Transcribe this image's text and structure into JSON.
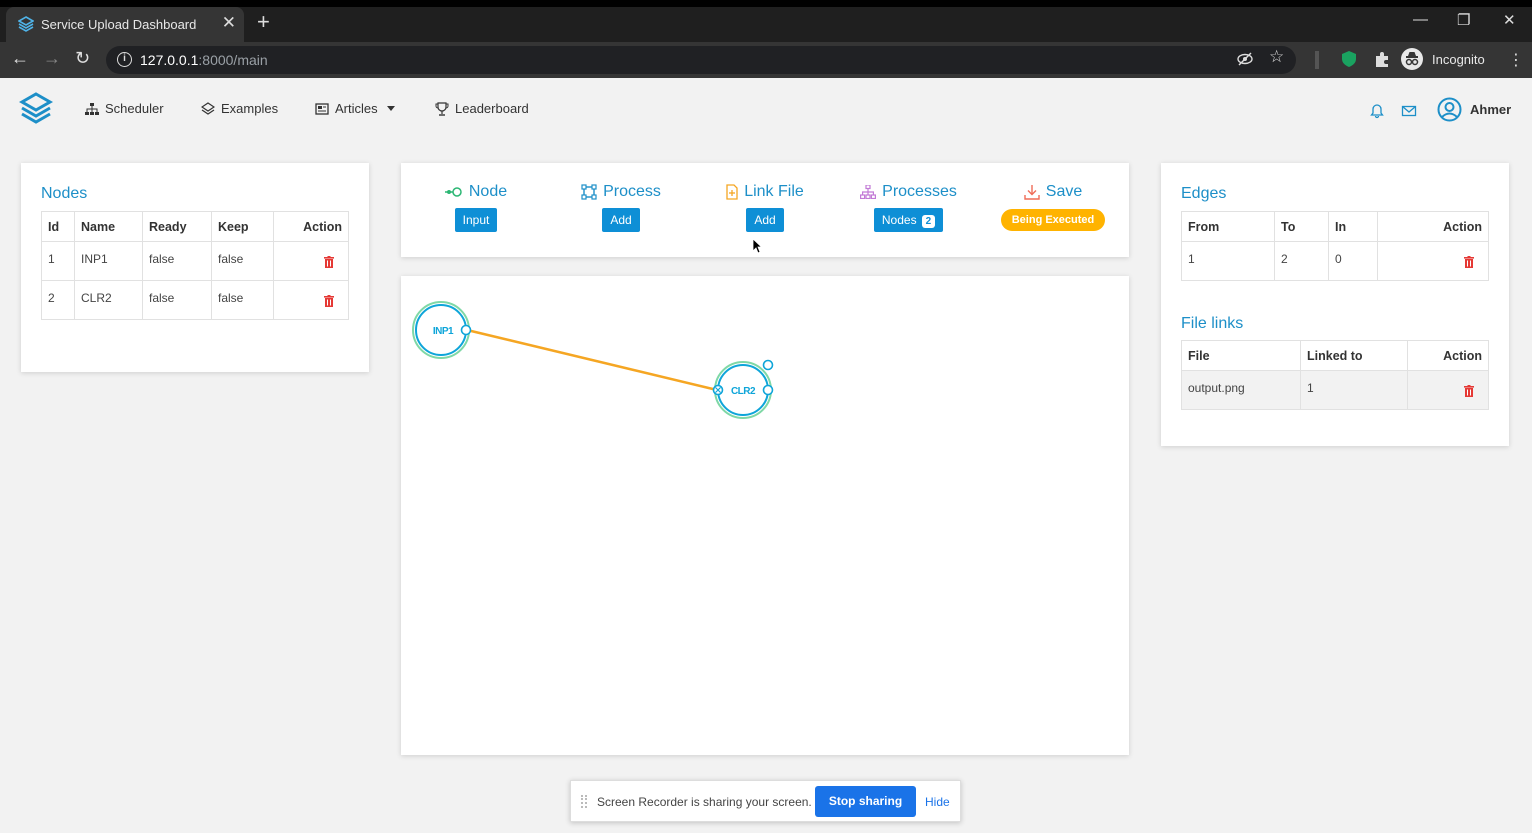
{
  "browser": {
    "tab_title": "Service Upload Dashboard",
    "url_host": "127.0.0.1",
    "url_rest": ":8000/main",
    "profile_label": "Incognito"
  },
  "navbar": {
    "items": [
      {
        "label": "Scheduler",
        "icon": "sitemap-icon"
      },
      {
        "label": "Examples",
        "icon": "layers-icon"
      },
      {
        "label": "Articles",
        "icon": "newspaper-icon"
      },
      {
        "label": "Leaderboard",
        "icon": "trophy-icon"
      }
    ],
    "user_name": "Ahmer"
  },
  "nodes_panel": {
    "title": "Nodes",
    "columns": [
      "Id",
      "Name",
      "Ready",
      "Keep",
      "Action"
    ],
    "rows": [
      {
        "id": "1",
        "name": "INP1",
        "ready": "false",
        "keep": "false"
      },
      {
        "id": "2",
        "name": "CLR2",
        "ready": "false",
        "keep": "false"
      }
    ]
  },
  "toolbar": {
    "node": {
      "label": "Node",
      "button": "Input"
    },
    "process": {
      "label": "Process",
      "button": "Add"
    },
    "link_file": {
      "label": "Link File",
      "button": "Add"
    },
    "processes": {
      "label": "Processes",
      "button": "Nodes",
      "badge": "2"
    },
    "save": {
      "label": "Save",
      "status": "Being Executed"
    }
  },
  "canvas": {
    "nodes": [
      {
        "label": "INP1"
      },
      {
        "label": "CLR2"
      }
    ]
  },
  "edges_panel": {
    "title": "Edges",
    "columns": [
      "From",
      "To",
      "In",
      "Action"
    ],
    "rows": [
      {
        "from": "1",
        "to": "2",
        "in": "0"
      }
    ]
  },
  "file_links_panel": {
    "title": "File links",
    "columns": [
      "File",
      "Linked to",
      "Action"
    ],
    "rows": [
      {
        "file": "output.png",
        "linked_to": "1"
      }
    ]
  },
  "share_bar": {
    "message": "Screen Recorder is sharing your screen.",
    "stop_label": "Stop sharing",
    "hide_label": "Hide"
  },
  "colors": {
    "accent": "#1d8fc8",
    "button": "#0e8fd6",
    "status_pill": "#ffb300",
    "edge_line": "#f5a623",
    "delete": "#e53935"
  }
}
